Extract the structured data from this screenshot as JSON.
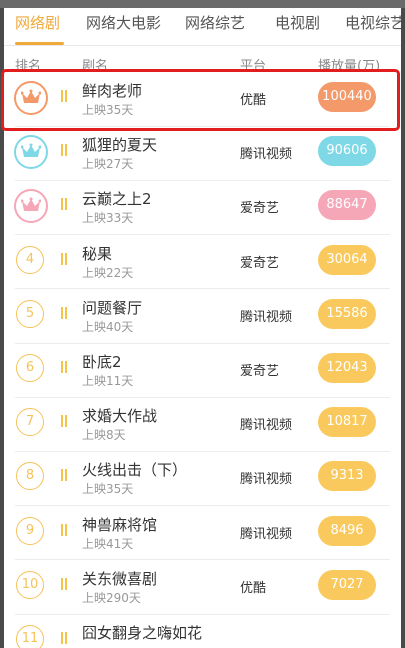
{
  "tabs": [
    "网络剧",
    "网络大电影",
    "网络综艺",
    "电视剧",
    "电视综艺"
  ],
  "active_tab": 0,
  "header": {
    "rank": "排名",
    "name": "剧名",
    "platform": "平台",
    "plays": "播放量(万)"
  },
  "colors": {
    "accent": "#f0a93b",
    "rank1": "#f3996a",
    "rank2": "#7fd8e6",
    "rank3": "#f5a6b7",
    "other": "#f9c95d",
    "highlight": "#e11d1d"
  },
  "rows": [
    {
      "rank": "1",
      "name": "鲜肉老师",
      "sub": "上映35天",
      "platform": "优酷",
      "plays": "100440",
      "crown": "rank1"
    },
    {
      "rank": "2",
      "name": "狐狸的夏天",
      "sub": "上映27天",
      "platform": "腾讯视频",
      "plays": "90606",
      "crown": "rank2"
    },
    {
      "rank": "3",
      "name": "云巅之上2",
      "sub": "上映33天",
      "platform": "爱奇艺",
      "plays": "88647",
      "crown": "rank3"
    },
    {
      "rank": "4",
      "name": "秘果",
      "sub": "上映22天",
      "platform": "爱奇艺",
      "plays": "30064"
    },
    {
      "rank": "5",
      "name": "问题餐厅",
      "sub": "上映40天",
      "platform": "腾讯视频",
      "plays": "15586"
    },
    {
      "rank": "6",
      "name": "卧底2",
      "sub": "上映11天",
      "platform": "爱奇艺",
      "plays": "12043"
    },
    {
      "rank": "7",
      "name": "求婚大作战",
      "sub": "上映8天",
      "platform": "腾讯视频",
      "plays": "10817"
    },
    {
      "rank": "8",
      "name": "火线出击（下）",
      "sub": "上映35天",
      "platform": "腾讯视频",
      "plays": "9313"
    },
    {
      "rank": "9",
      "name": "神兽麻将馆",
      "sub": "上映41天",
      "platform": "腾讯视频",
      "plays": "8496"
    },
    {
      "rank": "10",
      "name": "关东微喜剧",
      "sub": "上映290天",
      "platform": "优酷",
      "plays": "7027"
    },
    {
      "rank": "11",
      "name": "囧女翻身之嗨如花",
      "sub": "",
      "platform": "",
      "plays": ""
    }
  ]
}
